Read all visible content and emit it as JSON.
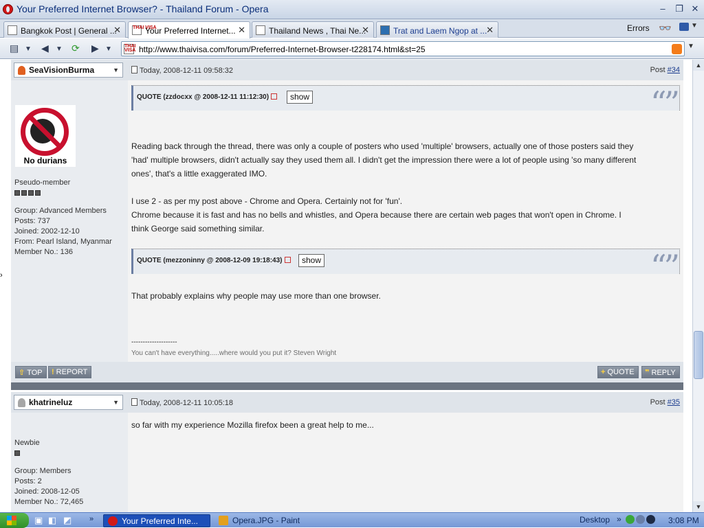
{
  "window": {
    "title": "Your Preferred Internet Browser? - Thailand Forum - Opera",
    "minimize": "–",
    "restore": "❐",
    "close": "✕"
  },
  "tabs": [
    {
      "label": "Bangkok Post | General ...",
      "active": false
    },
    {
      "label": "Your Preferred Internet...",
      "active": true
    },
    {
      "label": "Thailand News , Thai Ne...",
      "active": false
    },
    {
      "label": "Trat and Laem Ngop at ...",
      "active": false
    }
  ],
  "toolbar": {
    "errors": "Errors",
    "favicon_text": "THAI VISA",
    "address": "http://www.thaivisa.com/forum/Preferred-Internet-Browser-t228174.html&st=25"
  },
  "posts": [
    {
      "username": "SeaVisionBurma",
      "date": "Today, 2008-12-11 09:58:32",
      "post_prefix": "Post ",
      "post_number": "#34",
      "avatar_caption": "No durians",
      "rank": "Pseudo-member",
      "group": "Group: Advanced Members",
      "posts": "Posts: 737",
      "joined": "Joined: 2002-12-10",
      "from": "From: Pearl Island, Myanmar",
      "member_no": "Member No.: 136",
      "quote1_label": "QUOTE (zzdocxx @ 2008-12-11 11:12:30)",
      "quote2_label": "QUOTE (mezzoninny @ 2008-12-09 19:18:43)",
      "show_label": "show",
      "body_p1_l1": "Reading back through the thread, there was only a couple of posters who used 'multiple' browsers, actually one of those posters said they",
      "body_p1_l2": "'had' multiple browsers, didn't actually say they used them all. I didn't get the impression there were a lot of people using 'so many different",
      "body_p1_l3": "ones', that's a little exaggerated IMO.",
      "body_p2_l1": "I use 2 - as per my post above - Chrome and Opera. Certainly not for 'fun'.",
      "body_p2_l2": "Chrome because it is fast and has no bells and whistles, and Opera because there are certain web pages that won't open in Chrome. I",
      "body_p2_l3": "think George said something similar.",
      "body_p3": "That probably explains why people may use more than one browser.",
      "sig_line": "--------------------",
      "sig_text": "You can't have everything.....where would you put it?  Steven Wright"
    },
    {
      "username": "khatrineluz",
      "date": "Today, 2008-12-11 10:05:18",
      "post_prefix": "Post ",
      "post_number": "#35",
      "rank": "Newbie",
      "group": "Group: Members",
      "posts": "Posts: 2",
      "joined": "Joined: 2008-12-05",
      "member_no": "Member No.: 72,465",
      "body": "so far with my experience Mozilla firefox been a great help to me..."
    }
  ],
  "post_footer": {
    "top": "TOP",
    "report": "REPORT",
    "quote": "QUOTE",
    "reply": "REPLY"
  },
  "taskbar": {
    "items": [
      {
        "label": "Your Preferred Inte...",
        "active": true
      },
      {
        "label": "Opera.JPG - Paint",
        "active": false
      }
    ],
    "desktop": "Desktop",
    "clock": "3:08 PM"
  }
}
